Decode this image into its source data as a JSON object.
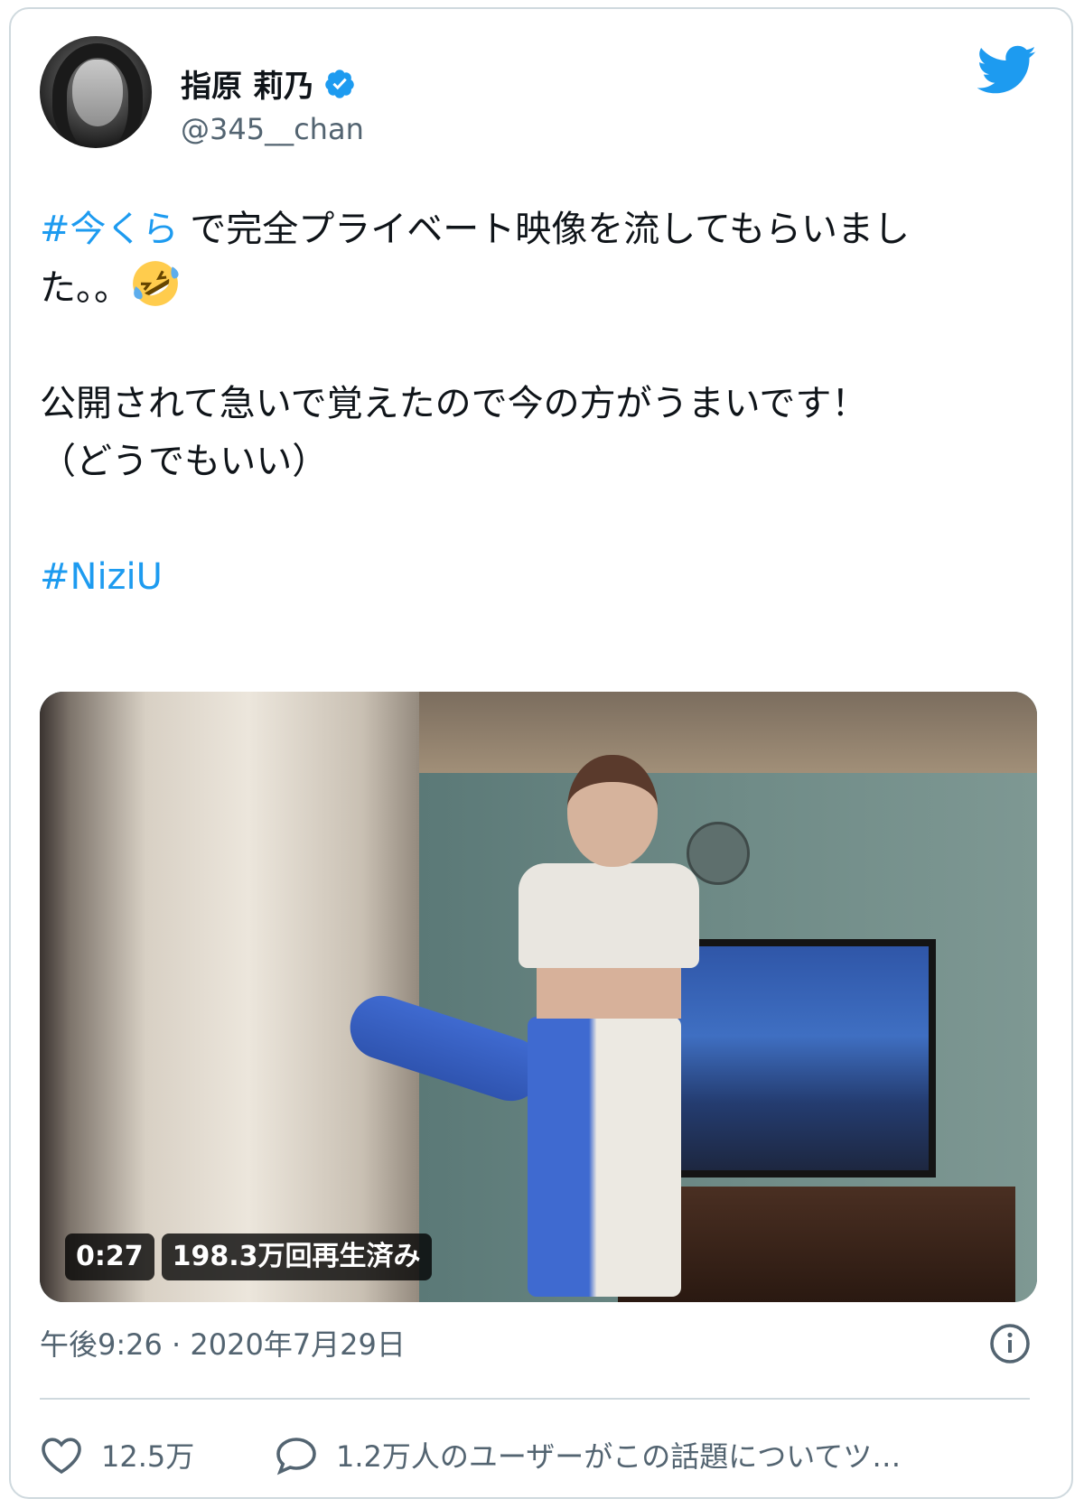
{
  "author": {
    "display_name": "指原 莉乃",
    "handle": "@345__chan",
    "verified": true
  },
  "tweet": {
    "hashtag1": "#今くら",
    "line1": " で完全プライベート映像を流してもらいまし",
    "line2": "た。。",
    "line2_emoji": "rolling-on-floor-laughing-emoji",
    "line3": "公開されて急いで覚えたので今の方がうまいです！",
    "line4": "（どうでもいい）",
    "hashtag2": "#NiziU"
  },
  "video": {
    "duration": "0:27",
    "views": "198.3万回再生済み"
  },
  "timestamp": "午後9:26 · 2020年7月29日",
  "actions": {
    "likes": "12.5万",
    "conversation": "1.2万人のユーザーがこの話題についてツ…"
  },
  "colors": {
    "link": "#1d9bf0",
    "secondary": "#536471",
    "border": "#cfd9de"
  }
}
